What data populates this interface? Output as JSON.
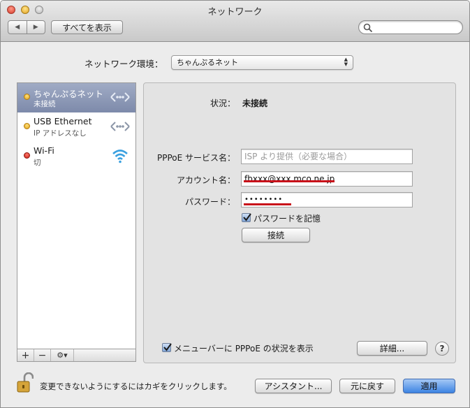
{
  "window": {
    "title": "ネットワーク",
    "nav_back_icon": "◀",
    "nav_forward_icon": "▶",
    "show_all_label": "すべてを表示",
    "search_placeholder": ""
  },
  "location": {
    "label": "ネットワーク環境：",
    "selected": "ちゃんぷるネット"
  },
  "services": [
    {
      "name": "ちゃんぷるネット",
      "status": "未接続",
      "status_color": "yellow",
      "icon": "ppp-icon",
      "selected": true
    },
    {
      "name": "USB Ethernet",
      "status": "IP アドレスなし",
      "status_color": "yellow",
      "icon": "ethernet-icon",
      "selected": false
    },
    {
      "name": "Wi-Fi",
      "status": "切",
      "status_color": "red",
      "icon": "wifi-icon",
      "selected": false
    }
  ],
  "sidebar_controls": {
    "add": "+",
    "remove": "−",
    "gear": "⚙▾"
  },
  "detail": {
    "status_label": "状況：",
    "status_value": "未接続",
    "service_name_label": "PPPoE サービス名：",
    "service_name_placeholder": "ISP より提供（必要な場合）",
    "account_label": "アカウント名：",
    "account_value": "fbxxx@xxx.mco.ne.jp",
    "password_label": "パスワード：",
    "password_value": "••••••••",
    "remember_label": "パスワードを記憶",
    "remember_checked": true,
    "connect_label": "接続",
    "show_status_label": "メニューバーに PPPoE の状況を表示",
    "show_status_checked": true,
    "advanced_label": "詳細...",
    "help_label": "?"
  },
  "footer": {
    "lock_text": "変更できないようにするにはカギをクリックします。",
    "assistant_label": "アシスタント...",
    "revert_label": "元に戻す",
    "apply_label": "適用"
  },
  "colors": {
    "selection": "#8a96b4",
    "apply_button": "#3d84e3",
    "annotation_underline": "#c8101a",
    "status_yellow": "#e0a21a",
    "status_red": "#c81e14"
  }
}
